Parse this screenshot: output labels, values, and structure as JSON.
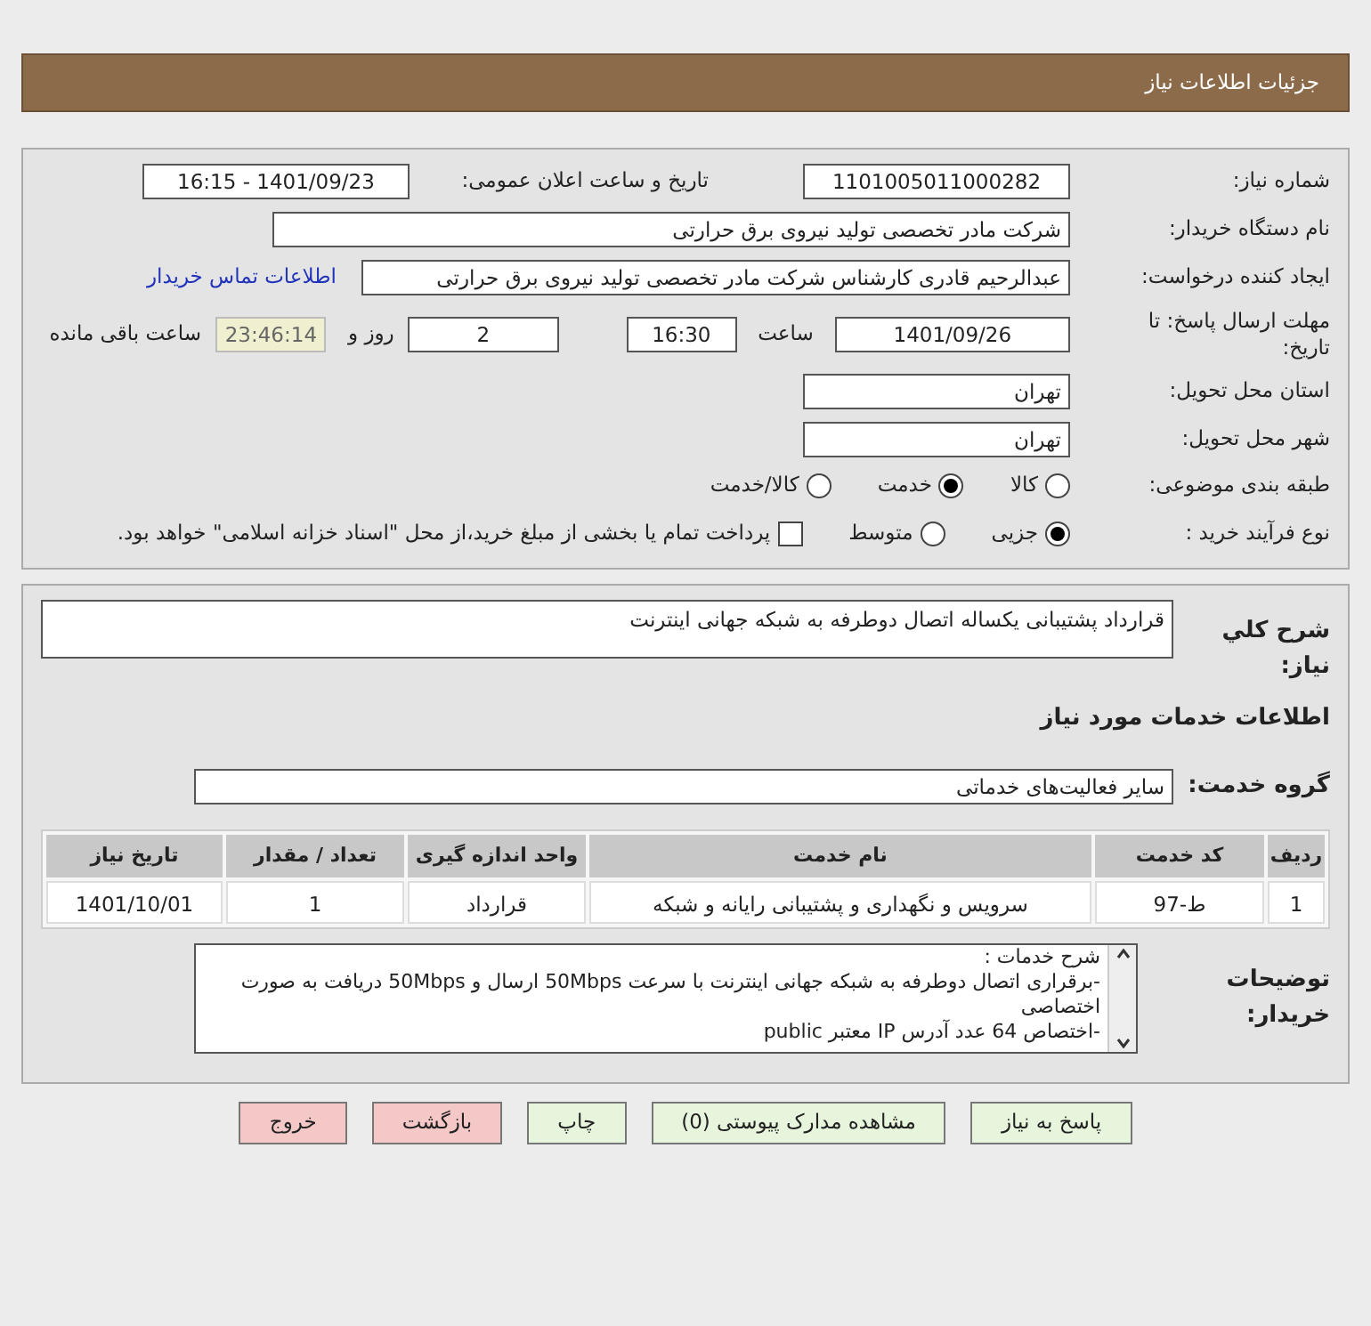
{
  "header": {
    "title": "جزئیات اطلاعات نیاز"
  },
  "need_number": {
    "label": "شماره نیاز:",
    "value": "1101005011000282"
  },
  "announce": {
    "label": "تاریخ و ساعت اعلان عمومی:",
    "value": "1401/09/23 - 16:15"
  },
  "buyer_org": {
    "label": "نام دستگاه خریدار:",
    "value": "شرکت مادر تخصصی تولید نیروی برق حرارتی"
  },
  "requester": {
    "label": "ایجاد کننده درخواست:",
    "value": "عبدالرحیم قادری کارشناس شرکت مادر تخصصی تولید نیروی برق حرارتی",
    "link": "اطلاعات تماس خریدار"
  },
  "deadline": {
    "label": "مهلت ارسال پاسخ: تا تاریخ:",
    "date": "1401/09/26",
    "time_label": "ساعت",
    "time": "16:30",
    "days": "2",
    "days_label": "روز و",
    "remaining": "23:46:14",
    "remaining_label": "ساعت باقی مانده"
  },
  "province": {
    "label": "استان محل تحویل:",
    "value": "تهران"
  },
  "city": {
    "label": "شهر محل تحویل:",
    "value": "تهران"
  },
  "category": {
    "label": "طبقه بندی موضوعی:",
    "options": [
      {
        "label": "کالا",
        "selected": false
      },
      {
        "label": "خدمت",
        "selected": true
      },
      {
        "label": "کالا/خدمت",
        "selected": false
      }
    ]
  },
  "process": {
    "label": "نوع فرآیند خرید :",
    "options": [
      {
        "label": "جزیی",
        "selected": true
      },
      {
        "label": "متوسط",
        "selected": false
      }
    ],
    "payment": {
      "checked": false,
      "text": "پرداخت تمام یا بخشی از مبلغ خرید،از محل \"اسناد خزانه اسلامی\" خواهد بود."
    }
  },
  "summary": {
    "label": "شرح کلي نياز:",
    "value": "قرارداد پشتیبانی یکساله اتصال دوطرفه به شبکه جهانی اینترنت"
  },
  "services_title": "اطلاعات خدمات مورد نیاز",
  "service_group": {
    "label": "گروه خدمت:",
    "value": "سایر فعالیت‌های خدماتی"
  },
  "table": {
    "columns": [
      "ردیف",
      "کد خدمت",
      "نام خدمت",
      "واحد اندازه گیری",
      "تعداد / مقدار",
      "تاریخ نیاز"
    ],
    "rows": [
      [
        "1",
        "ط-97",
        "سرویس و نگهداری و پشتیبانی رایانه و شبکه",
        "قرارداد",
        "1",
        "1401/10/01"
      ]
    ]
  },
  "buyer_notes": {
    "label": "توضیحات خریدار:",
    "lines": [
      "شرح خدمات :",
      "-برقراری اتصال دوطرفه به شبکه جهانی اینترنت با سرعت 50Mbps ارسال  و 50Mbps دریافت به صورت اختصاصی",
      "-اختصاص 64 عدد آدرس IP معتبر public"
    ]
  },
  "buttons": [
    {
      "label": "پاسخ به نیاز",
      "kind": "green"
    },
    {
      "label": "مشاهده مدارک پیوستی (0)",
      "kind": "green"
    },
    {
      "label": "چاپ",
      "kind": "green"
    },
    {
      "label": "بازگشت",
      "kind": "pink"
    },
    {
      "label": "خروج",
      "kind": "pink"
    }
  ]
}
